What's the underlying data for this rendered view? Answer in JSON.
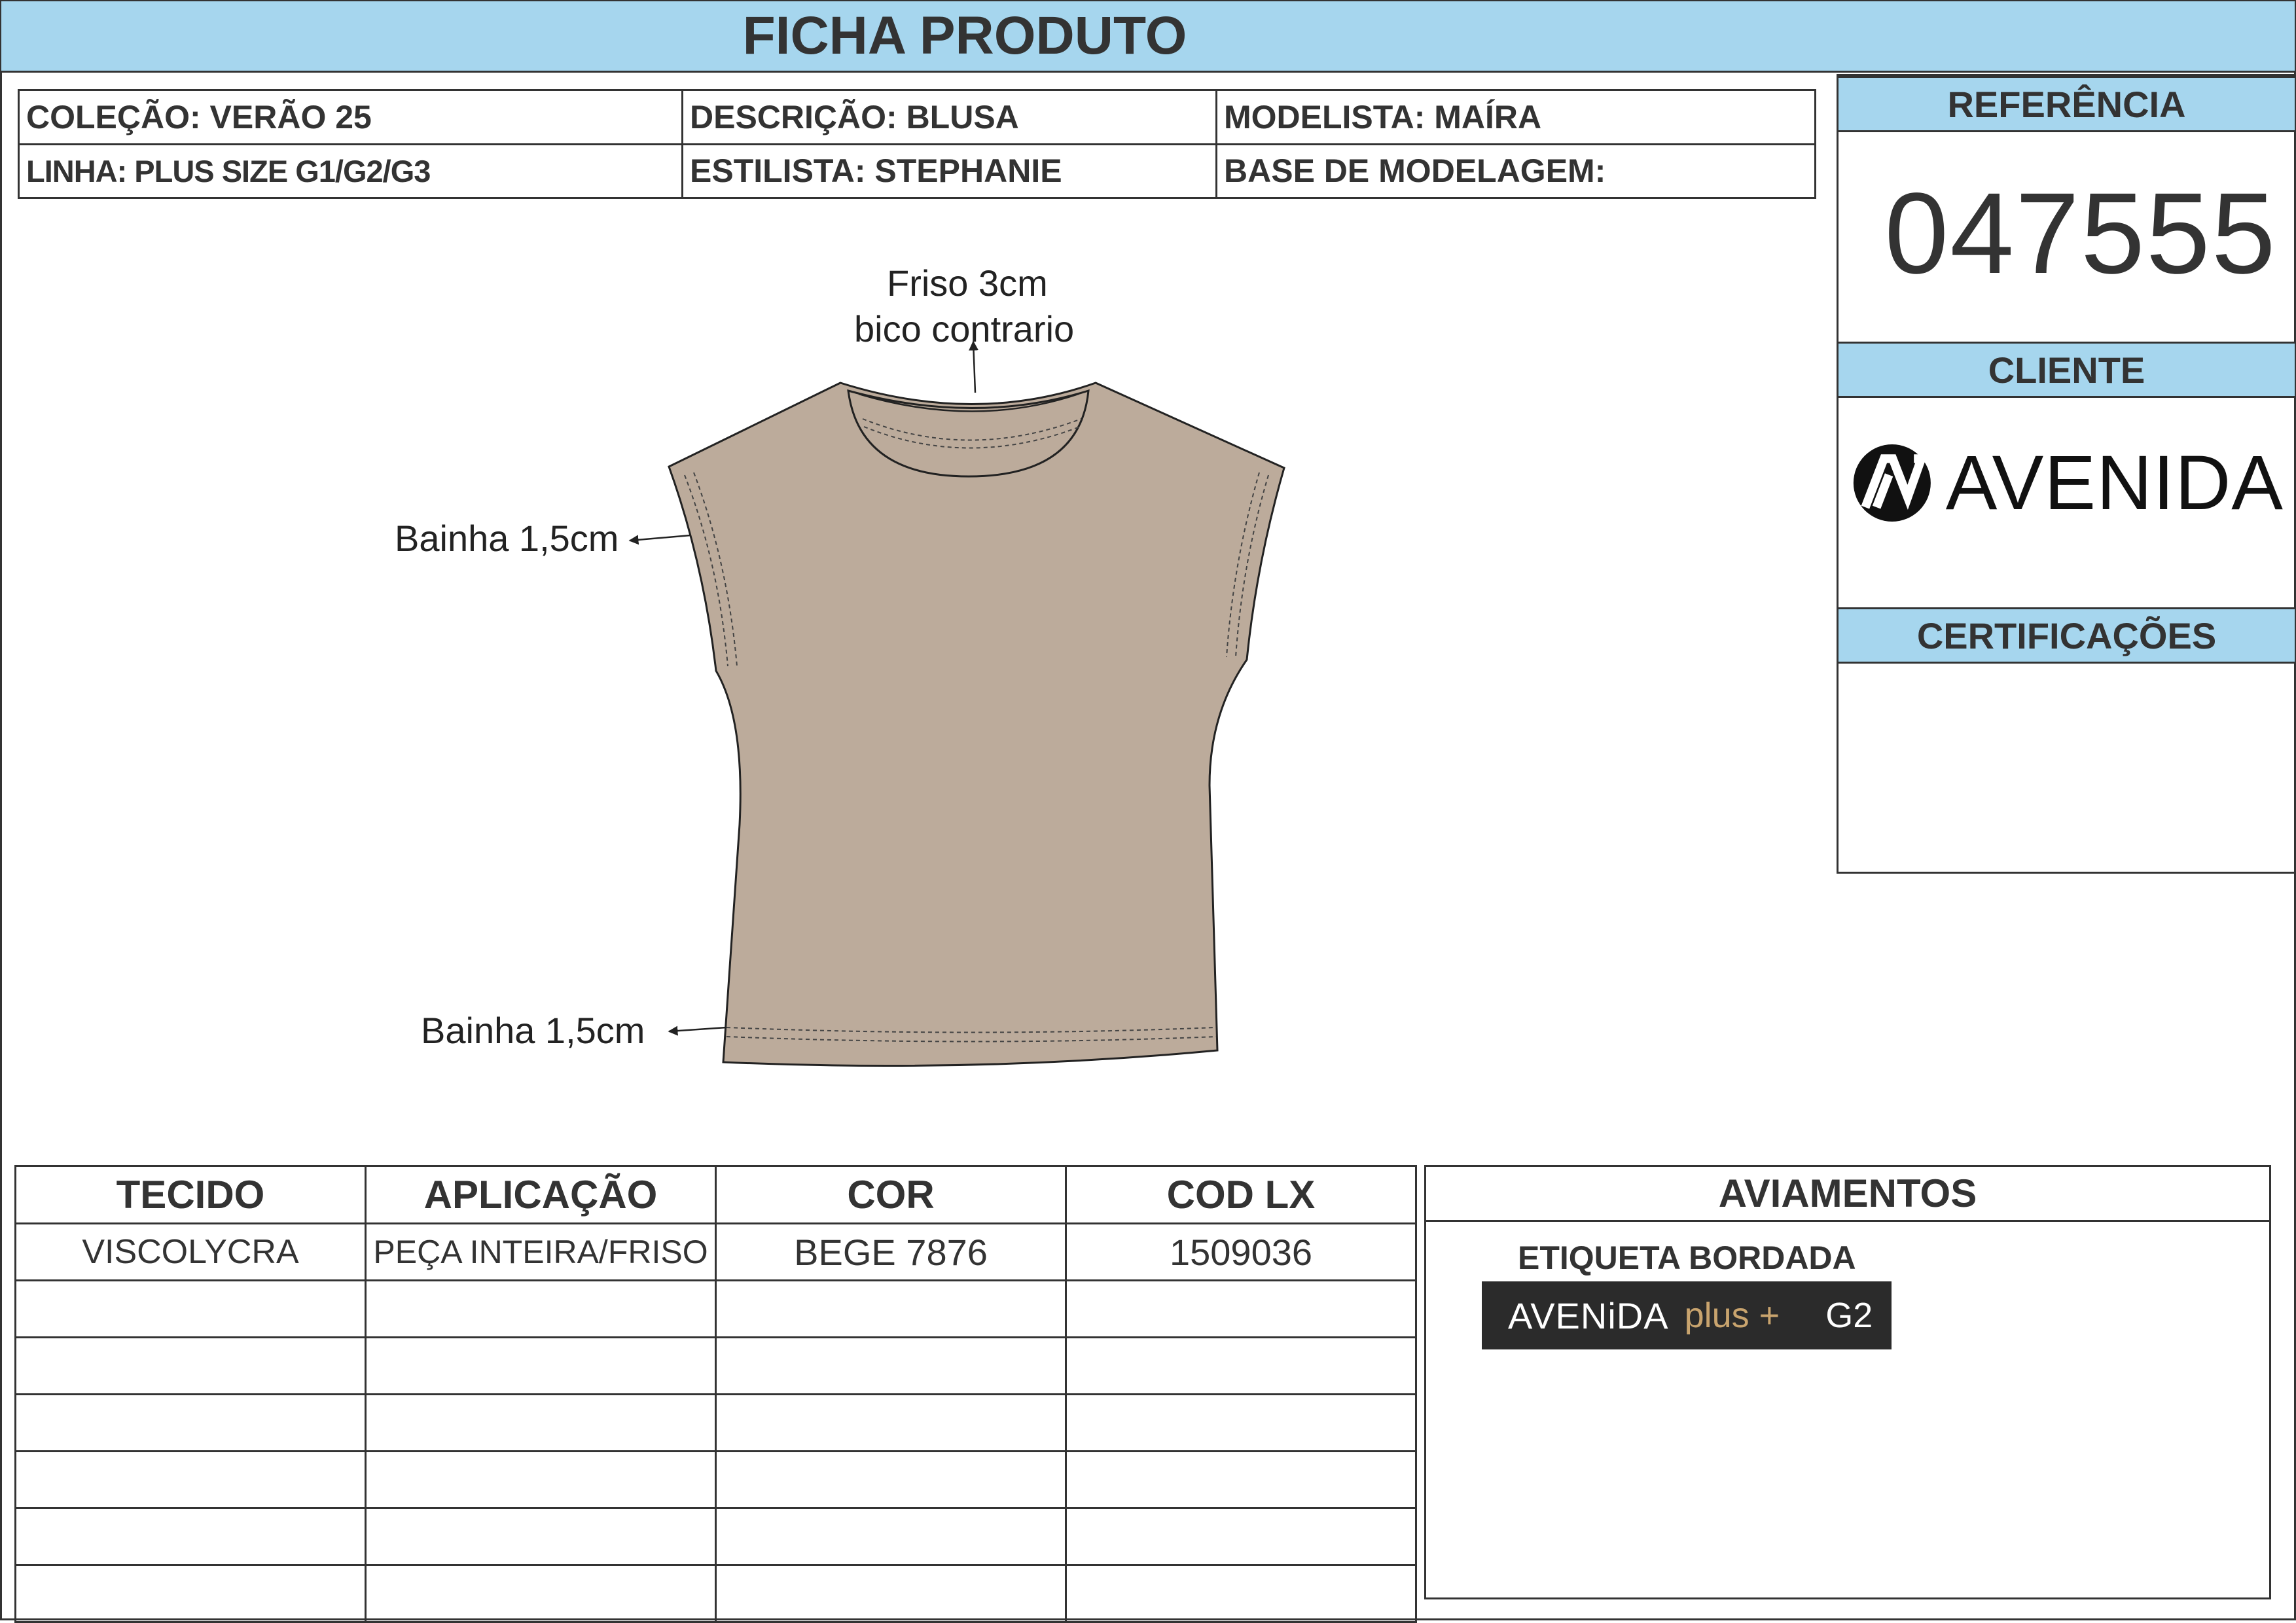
{
  "title": "FICHA PRODUTO",
  "info": {
    "colecao": "COLEÇÃO: VERÃO 25",
    "descricao": "DESCRIÇÃO: BLUSA",
    "modelista": "MODELISTA: MAÍRA",
    "linha": "LINHA: PLUS SIZE G1/G2/G3",
    "estilista": "ESTILISTA: STEPHANIE",
    "base_modelagem": "BASE DE MODELAGEM:"
  },
  "side": {
    "referencia_label": "REFERÊNCIA",
    "referencia_value": "047555",
    "cliente_label": "CLIENTE",
    "cliente_logo": "AVENIDA",
    "certificacoes_label": "CERTIFICAÇÕES"
  },
  "garment": {
    "fill_color": "#bcab9b",
    "note_neck_1": "Friso 3cm",
    "note_neck_2": "bico contrario",
    "note_sleeve": "Bainha 1,5cm",
    "note_hem": "Bainha 1,5cm"
  },
  "fabric_table": {
    "headers": [
      "TECIDO",
      "APLICAÇÃO",
      "COR",
      "COD LX"
    ],
    "rows": [
      [
        "VISCOLYCRA",
        "PEÇA INTEIRA/FRISO",
        "BEGE 7876",
        "1509036"
      ],
      [
        "",
        "",
        "",
        ""
      ],
      [
        "",
        "",
        "",
        ""
      ],
      [
        "",
        "",
        "",
        ""
      ],
      [
        "",
        "",
        "",
        ""
      ],
      [
        "",
        "",
        "",
        ""
      ],
      [
        "",
        "",
        "",
        ""
      ]
    ]
  },
  "aviamentos": {
    "header": "AVIAMENTOS",
    "item_name": "ETIQUETA BORDADA",
    "label_brand": "AVENiDA",
    "label_plus": "plus +",
    "label_size": "G2"
  },
  "colors": {
    "header_blue": "#a6d6ee",
    "label_dark": "#2b2b2b",
    "label_gold": "#c9a46e"
  }
}
